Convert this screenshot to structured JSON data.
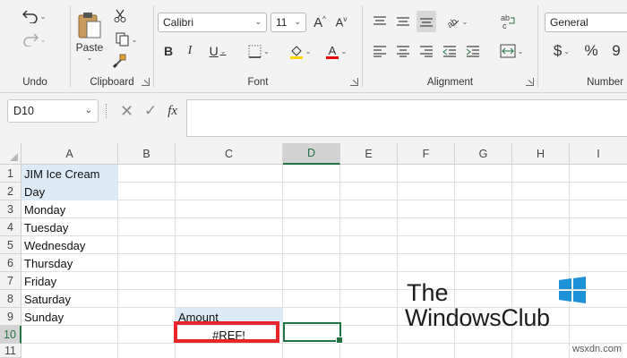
{
  "ribbon": {
    "undo": {
      "label": "Undo"
    },
    "clipboard": {
      "label": "Clipboard",
      "paste_label": "Paste"
    },
    "font": {
      "label": "Font",
      "font_name": "Calibri",
      "font_size": "11"
    },
    "alignment": {
      "label": "Alignment"
    },
    "number": {
      "label": "Number",
      "format": "General",
      "currency_symbol": "$",
      "percent_symbol": "%",
      "comma_symbol": "9"
    }
  },
  "formula_bar": {
    "name_box": "D10",
    "fx_symbol": "fx",
    "formula": ""
  },
  "grid": {
    "columns": [
      "A",
      "B",
      "C",
      "D",
      "E",
      "F",
      "G",
      "H",
      "I"
    ],
    "rows": [
      "1",
      "2",
      "3",
      "4",
      "5",
      "6",
      "7",
      "8",
      "9",
      "10",
      "11"
    ],
    "selected_column": "D",
    "selected_row": "10",
    "cells": {
      "A1": "JIM Ice Cream",
      "A2": "Day",
      "A3": "Monday",
      "A4": "Tuesday",
      "A5": "Wednesday",
      "A6": "Thursday",
      "A7": "Friday",
      "A8": "Saturday",
      "A9": "Sunday",
      "C9": "Amount",
      "C10": "#REF!"
    }
  },
  "watermark": {
    "line1": "The",
    "line2": "WindowsClub"
  },
  "footer": {
    "site": "wsxdn.com"
  },
  "colors": {
    "excel_green": "#217346",
    "highlight_red": "#e8262a",
    "header_fill": "#ddebf7"
  }
}
